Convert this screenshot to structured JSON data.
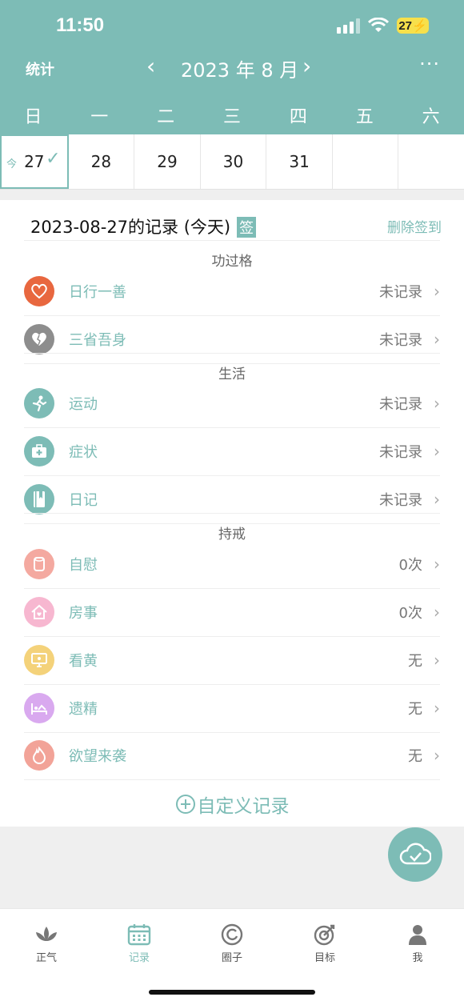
{
  "status": {
    "time": "11:50",
    "battery": "27"
  },
  "nav": {
    "stats": "统计",
    "month": "2023 年 8 月",
    "prev": "‹",
    "next": "›",
    "more": "···"
  },
  "weekdays": [
    "日",
    "一",
    "二",
    "三",
    "四",
    "五",
    "六"
  ],
  "days": [
    {
      "num": "27",
      "today_mark": "今",
      "checked": true
    },
    {
      "num": "28"
    },
    {
      "num": "29"
    },
    {
      "num": "30"
    },
    {
      "num": "31"
    },
    {
      "num": ""
    },
    {
      "num": ""
    }
  ],
  "record": {
    "title": "2023-08-27的记录 (今天)",
    "sign_badge": "签",
    "delete_label": "删除签到"
  },
  "sections": [
    {
      "title": "功过格",
      "items": [
        {
          "label": "日行一善",
          "value": "未记录",
          "icon": "heart-icon",
          "color": "#e8673f"
        },
        {
          "label": "三省吾身",
          "value": "未记录",
          "icon": "broken-heart-icon",
          "color": "#8d8d8d"
        }
      ]
    },
    {
      "title": "生活",
      "items": [
        {
          "label": "运动",
          "value": "未记录",
          "icon": "running-icon",
          "color": "#7dbcb6"
        },
        {
          "label": "症状",
          "value": "未记录",
          "icon": "medkit-icon",
          "color": "#7dbcb6"
        },
        {
          "label": "日记",
          "value": "未记录",
          "icon": "notebook-icon",
          "color": "#7dbcb6"
        }
      ]
    },
    {
      "title": "持戒",
      "items": [
        {
          "label": "自慰",
          "value": "0次",
          "icon": "tissue-roll-icon",
          "color": "#f4a9a0"
        },
        {
          "label": "房事",
          "value": "0次",
          "icon": "house-icon",
          "color": "#f7b7d0"
        },
        {
          "label": "看黄",
          "value": "无",
          "icon": "monitor-icon",
          "color": "#f4d27a"
        },
        {
          "label": "遗精",
          "value": "无",
          "icon": "bed-icon",
          "color": "#d9a9ef"
        },
        {
          "label": "欲望来袭",
          "value": "无",
          "icon": "flame-icon",
          "color": "#f2a398"
        }
      ]
    }
  ],
  "custom_record": "自定义记录",
  "tabs": [
    {
      "label": "正气",
      "icon": "lotus-icon"
    },
    {
      "label": "记录",
      "icon": "calendar-icon",
      "active": true
    },
    {
      "label": "圈子",
      "icon": "circle-icon"
    },
    {
      "label": "目标",
      "icon": "target-icon"
    },
    {
      "label": "我",
      "icon": "person-icon"
    }
  ]
}
